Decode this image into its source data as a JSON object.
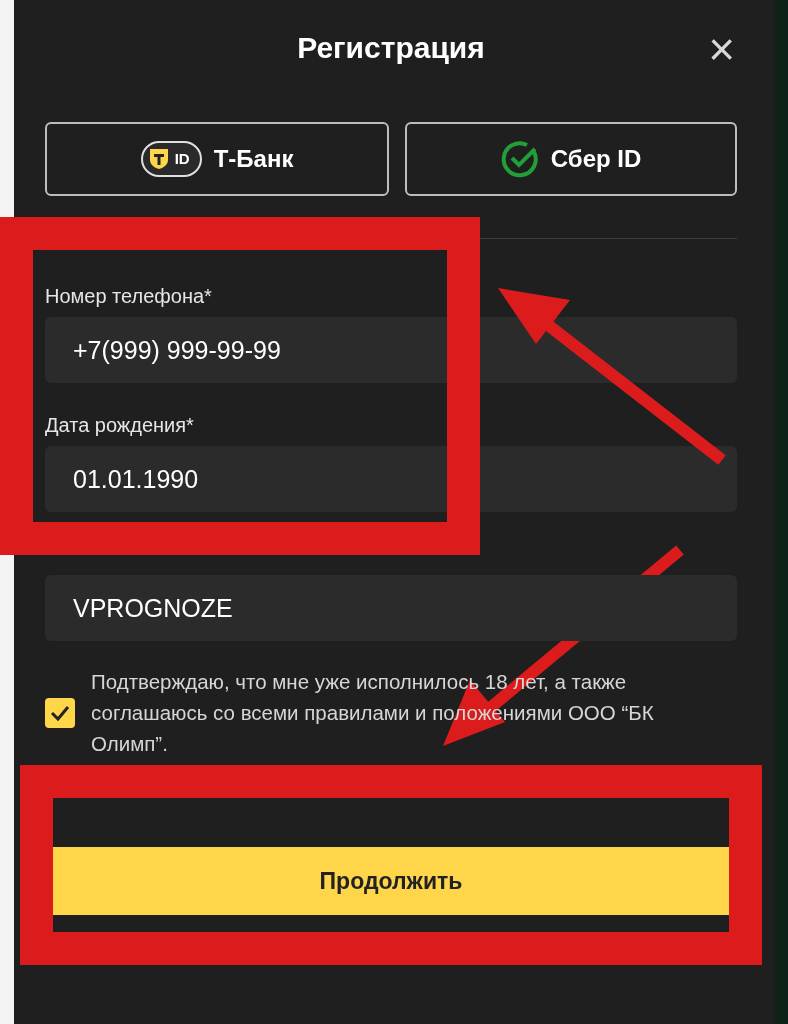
{
  "dialog": {
    "title": "Регистрация",
    "close": "×"
  },
  "sso_buttons": [
    {
      "kind": "tbank",
      "badge": "ID",
      "label": "Т-Банк"
    },
    {
      "kind": "sber",
      "label": "Сбер ID"
    }
  ],
  "fields": [
    {
      "label": "Номер телефона*",
      "value": "+7(999) 999-99-99"
    },
    {
      "label": "Дата рождения*",
      "value": "01.01.1990"
    },
    {
      "value": "VPROGNOZE"
    }
  ],
  "consent": {
    "checked": true,
    "text": "Подтверждаю, что мне уже исполнилось 18 лет, а также соглашаюсь со всеми правилами и положениями ООО “БК Олимп”."
  },
  "submit": "Продолжить"
}
